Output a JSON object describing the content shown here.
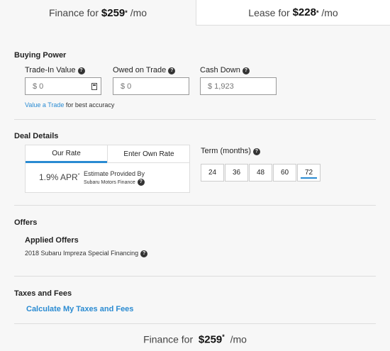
{
  "tabs": {
    "finance": {
      "prefix": "Finance for ",
      "amount": "$259",
      "mark": "*",
      "suffix": " /mo"
    },
    "lease": {
      "prefix": "Lease for ",
      "amount": "$228",
      "mark": "*",
      "suffix": " /mo"
    }
  },
  "buying_power": {
    "title": "Buying Power",
    "trade_in": {
      "label": "Trade-In Value",
      "value": "$ 0"
    },
    "owed": {
      "label": "Owed on Trade",
      "value": "$ 0"
    },
    "cash_down": {
      "label": "Cash Down",
      "value": "$ 1,923"
    },
    "value_trade_link": "Value a Trade",
    "value_trade_hint": " for best accuracy"
  },
  "deal_details": {
    "title": "Deal Details",
    "rate_tabs": [
      "Our Rate",
      "Enter Own Rate"
    ],
    "apr": "1.9% APR",
    "apr_mark": "*",
    "estimate_line1": "Estimate Provided By",
    "estimate_line2": "Subaru Motors Finance",
    "term_label": "Term (months)",
    "terms": [
      "24",
      "36",
      "48",
      "60",
      "72"
    ],
    "selected_term": "72"
  },
  "offers": {
    "title": "Offers",
    "applied_label": "Applied Offers",
    "items": [
      "2018 Subaru Impreza Special Financing"
    ]
  },
  "taxes": {
    "title": "Taxes and Fees",
    "link": "Calculate My Taxes and Fees"
  },
  "footer": {
    "prefix": "Finance for ",
    "amount": "$259",
    "mark": "*",
    "suffix": " /mo"
  },
  "colors": {
    "accent": "#2a8bd2",
    "background": "#f7f7f7"
  },
  "icons": {
    "help": "question-circle-icon",
    "calculator": "calculator-icon"
  }
}
